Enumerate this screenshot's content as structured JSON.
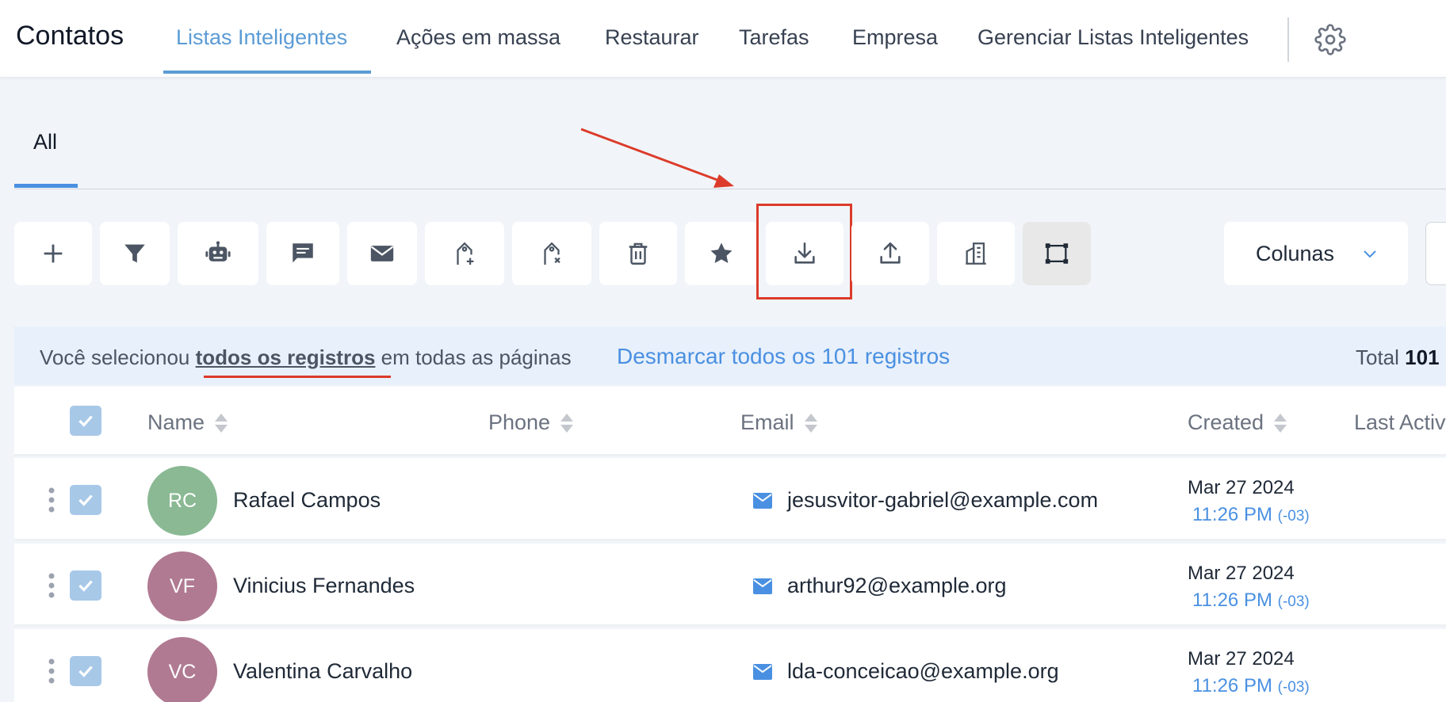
{
  "app": {
    "title": "Contatos"
  },
  "nav": {
    "tabs": [
      {
        "label": "Listas Inteligentes",
        "active": true
      },
      {
        "label": "Ações em massa"
      },
      {
        "label": "Restaurar"
      },
      {
        "label": "Tarefas"
      },
      {
        "label": "Empresa"
      },
      {
        "label": "Gerenciar Listas Inteligentes"
      }
    ],
    "settings_icon": "gear-icon"
  },
  "subtabs": [
    {
      "label": "All",
      "active": true
    }
  ],
  "toolbar": {
    "buttons": [
      {
        "icon": "plus-icon"
      },
      {
        "icon": "filter-icon"
      },
      {
        "icon": "robot-icon"
      },
      {
        "icon": "chat-icon"
      },
      {
        "icon": "mail-icon"
      },
      {
        "icon": "tag-add-icon"
      },
      {
        "icon": "tag-remove-icon"
      },
      {
        "icon": "trash-icon"
      },
      {
        "icon": "star-icon"
      },
      {
        "icon": "download-icon",
        "highlighted": true
      },
      {
        "icon": "upload-icon"
      },
      {
        "icon": "building-icon"
      },
      {
        "icon": "select-frame-icon",
        "active": true
      }
    ],
    "columns_label": "Colunas"
  },
  "banner": {
    "text_before": "Você selecionou ",
    "text_bold": "todos os registros",
    "text_after": " em todas as páginas",
    "link": "Desmarcar todos os 101 registros",
    "total_label": "Total ",
    "total_value": "101"
  },
  "table": {
    "columns": [
      "Name",
      "Phone",
      "Email",
      "Created",
      "Last Activity"
    ],
    "rows": [
      {
        "initials": "RC",
        "avatar_color": "#8ab994",
        "name": "Rafael Campos",
        "email": "jesusvitor-gabriel@example.com",
        "date": "Mar 27 2024",
        "time": "11:26 PM",
        "tz": "(-03)"
      },
      {
        "initials": "VF",
        "avatar_color": "#b07a92",
        "name": "Vinicius Fernandes",
        "email": "arthur92@example.org",
        "date": "Mar 27 2024",
        "time": "11:26 PM",
        "tz": "(-03)"
      },
      {
        "initials": "VC",
        "avatar_color": "#b07a92",
        "name": "Valentina Carvalho",
        "email": "lda-conceicao@example.org",
        "date": "Mar 27 2024",
        "time": "11:26 PM",
        "tz": "(-03)"
      }
    ]
  },
  "colors": {
    "accent": "#4a90e2",
    "annotation_red": "#dc3b2b"
  }
}
